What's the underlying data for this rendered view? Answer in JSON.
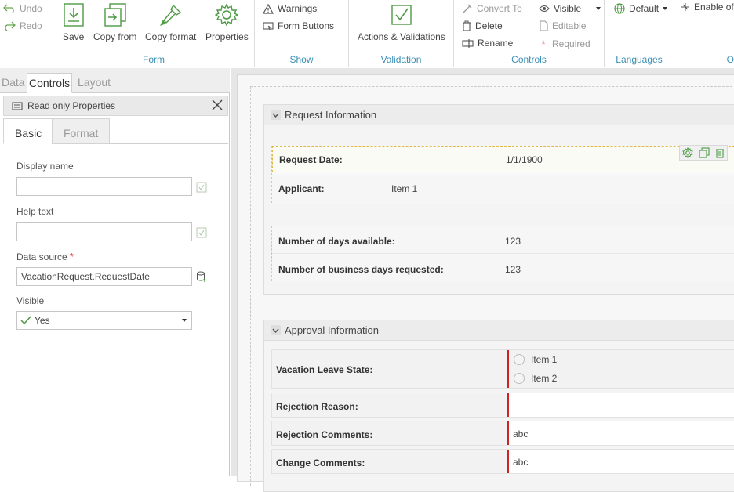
{
  "ribbon": {
    "undo": "Undo",
    "redo": "Redo",
    "form": {
      "label": "Form",
      "save": "Save",
      "copy_from": "Copy from",
      "copy_format": "Copy format",
      "properties": "Properties"
    },
    "show": {
      "label": "Show",
      "warnings": "Warnings",
      "form_buttons": "Form Buttons"
    },
    "validation": {
      "label": "Validation",
      "actions_validations": "Actions & Validations"
    },
    "controls": {
      "label": "Controls",
      "convert_to": "Convert To",
      "delete": "Delete",
      "rename": "Rename",
      "visible": "Visible",
      "editable": "Editable",
      "required": "Required"
    },
    "languages": {
      "label": "Languages",
      "default": "Default"
    },
    "other": {
      "enable": "Enable of",
      "label_partial": "O"
    }
  },
  "left_tabs": {
    "data": "Data",
    "controls": "Controls",
    "layout": "Layout"
  },
  "properties_panel": {
    "title": "Read only Properties",
    "tabs": {
      "basic": "Basic",
      "format": "Format"
    },
    "display_name": {
      "label": "Display name",
      "value": ""
    },
    "help_text": {
      "label": "Help text",
      "value": ""
    },
    "data_source": {
      "label": "Data source",
      "required_mark": "*",
      "value": "VacationRequest.RequestDate"
    },
    "visible": {
      "label": "Visible",
      "value": "Yes"
    }
  },
  "request_section": {
    "title": "Request Information",
    "rows": [
      {
        "label": "Request Date:",
        "value": "1/1/1900"
      },
      {
        "label": "Applicant:",
        "value": "Item 1"
      }
    ],
    "rows2": [
      {
        "label": "Number of days available:",
        "value": "123"
      },
      {
        "label": "Number of business days requested:",
        "value": "123"
      }
    ]
  },
  "approval_section": {
    "title": "Approval Information",
    "vacation_state": {
      "label": "Vacation Leave State:",
      "options": [
        "Item 1",
        "Item 2"
      ]
    },
    "rejection_reason": {
      "label": "Rejection Reason:",
      "value": ""
    },
    "rejection_comments": {
      "label": "Rejection Comments:",
      "value": "abc"
    },
    "change_comments": {
      "label": "Change Comments:",
      "value": "abc"
    }
  },
  "colors": {
    "accent": "#3b8fb5",
    "required": "#d32020",
    "icon_green": "#4e9a45"
  }
}
